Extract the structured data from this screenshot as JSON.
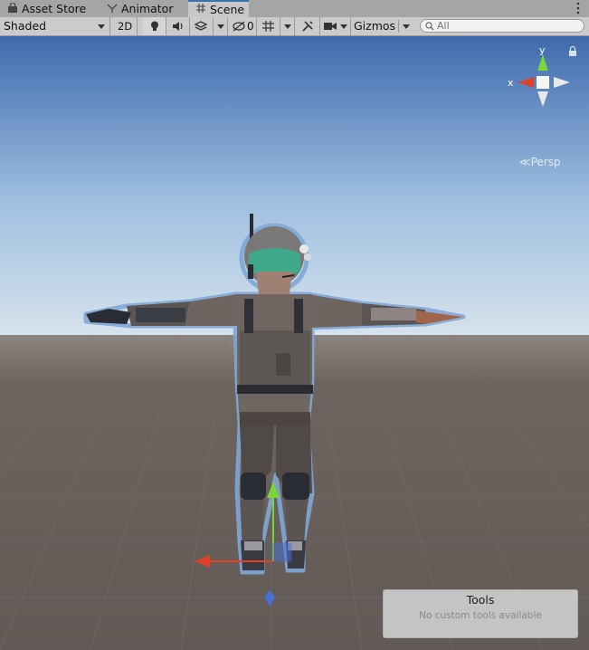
{
  "tabs": [
    {
      "label": "Asset Store",
      "icon": "shopping-bag-icon",
      "active": false
    },
    {
      "label": "Animator",
      "icon": "animator-icon",
      "active": false
    },
    {
      "label": "Scene",
      "icon": "grid-icon",
      "active": true
    }
  ],
  "toolbar": {
    "shading_mode": "Shaded",
    "two_d_label": "2D",
    "hidden_count": "0",
    "gizmos_label": "Gizmos",
    "search_placeholder": "All"
  },
  "viewport": {
    "projection_label": "Persp",
    "axis_x_label": "x",
    "axis_y_label": "y"
  },
  "tools_panel": {
    "title": "Tools",
    "message": "No custom tools available"
  },
  "colors": {
    "accent": "#3a72b0",
    "sky_top": "#3f6aad",
    "ground": "#665e59",
    "axis_x": "#e0412a",
    "axis_y": "#7ad43a",
    "axis_z": "#4a6fd4"
  }
}
